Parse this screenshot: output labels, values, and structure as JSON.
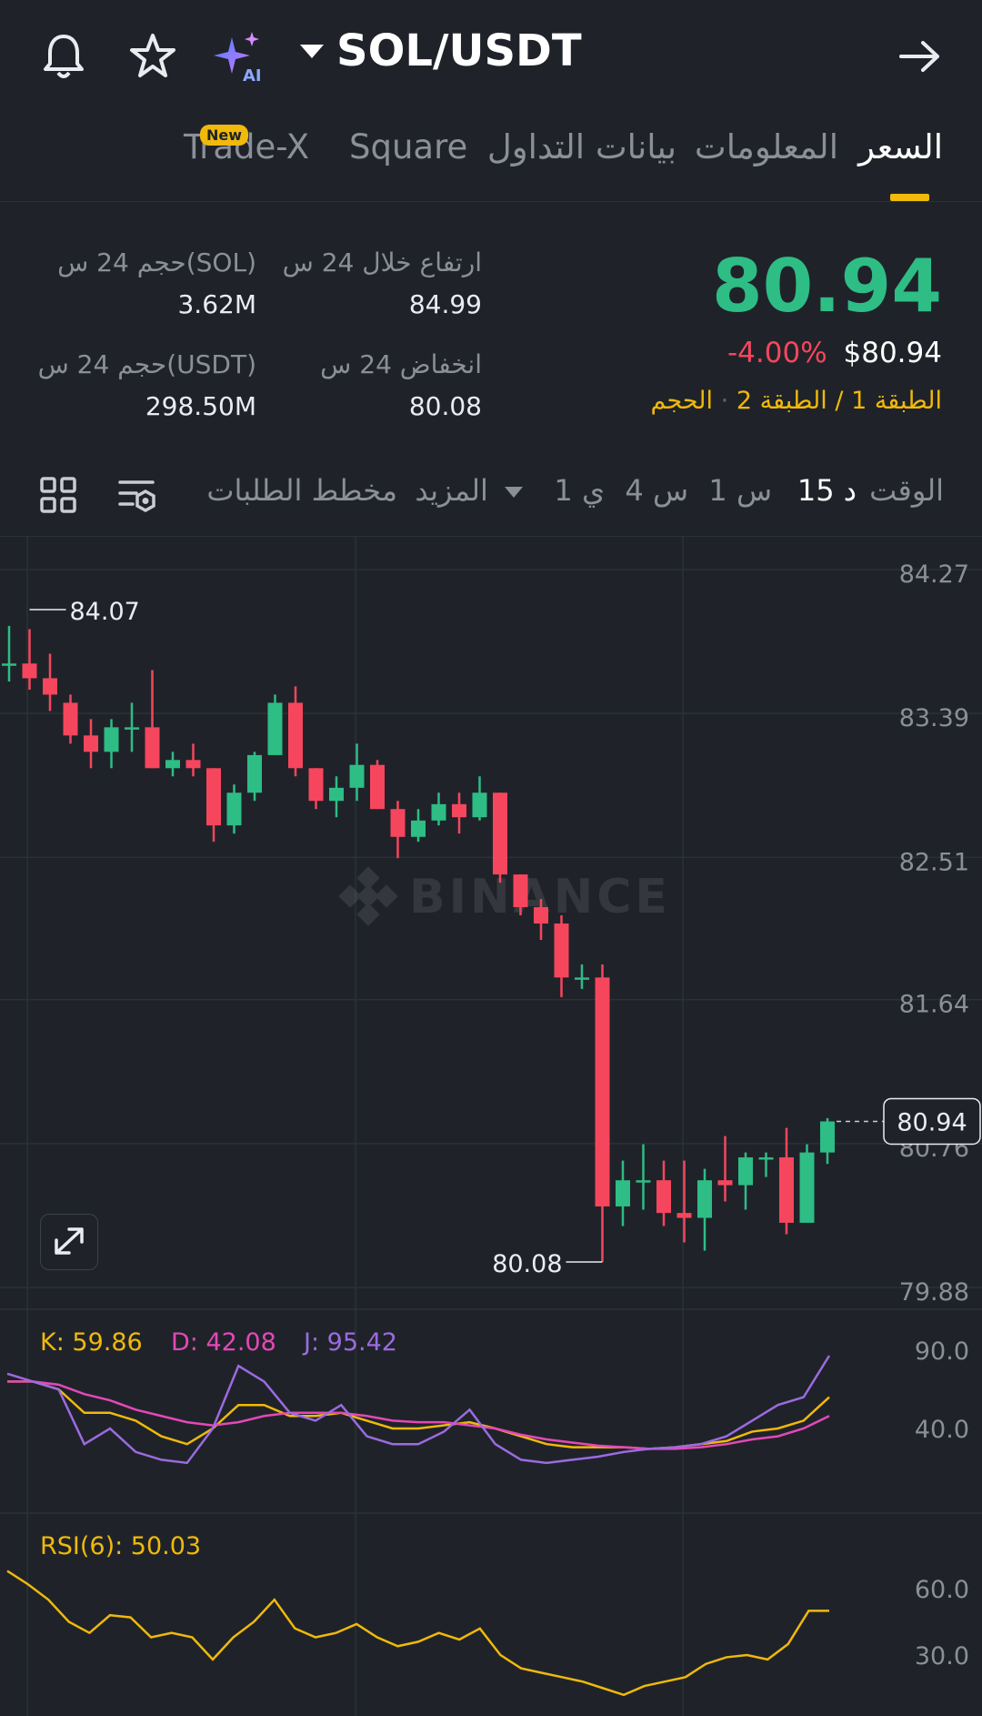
{
  "header": {
    "pair": "SOL/USDT",
    "icons": [
      "bell-icon",
      "star-icon",
      "ai-sparkle-icon",
      "dropdown-caret-icon",
      "arrow-right-icon"
    ],
    "ai_label": "AI"
  },
  "tabs": [
    {
      "label": "السعر",
      "active": true
    },
    {
      "label": "المعلومات",
      "active": false
    },
    {
      "label": "بيانات التداول",
      "active": false
    },
    {
      "label": "Square",
      "active": false
    },
    {
      "label": "Trade-X",
      "active": false,
      "badge": "New"
    }
  ],
  "ticker": {
    "last_price": "80.94",
    "change_pct": "-4.00%",
    "usd_price": "$80.94",
    "layers_text": {
      "layer1": "الطبقة 1",
      "sep1": "/",
      "layer2": "الطبقة 2",
      "dot": "·",
      "volume": "الحجم"
    },
    "stats": {
      "high_label": "ارتفاع خلال 24 س",
      "high_value": "84.99",
      "low_label": "انخفاض 24 س",
      "low_value": "80.08",
      "vol_sol_label": "حجم 24 س(SOL)",
      "vol_sol_value": "3.62M",
      "vol_usdt_label": "حجم 24 س(USDT)",
      "vol_usdt_value": "298.50M"
    },
    "colors": {
      "up": "#2ebd85",
      "down": "#f6465d",
      "accent": "#f0b90b"
    }
  },
  "toolbar": {
    "time_label": "الوقت",
    "intervals": [
      {
        "label": "15 د",
        "selected": true
      },
      {
        "label": "1 س",
        "selected": false
      },
      {
        "label": "4 س",
        "selected": false
      },
      {
        "label": "1 ي",
        "selected": false
      }
    ],
    "more_label": "المزيد",
    "orderbook_chart_label": "مخطط الطلبات",
    "icons": [
      "chart-settings-icon",
      "grid-layout-icon"
    ]
  },
  "chart_data": [
    {
      "type": "candlestick",
      "watermark": "BINANCE",
      "y_ticks": [
        "84.27",
        "83.39",
        "82.51",
        "81.64",
        "80.76",
        "79.88"
      ],
      "ylim": [
        79.88,
        84.27
      ],
      "current_price_tag": "80.94",
      "high_marker": "84.07",
      "low_marker": "80.08",
      "candles": [
        {
          "o": 83.74,
          "h": 83.97,
          "l": 83.63,
          "c": 83.74
        },
        {
          "o": 83.74,
          "h": 83.95,
          "l": 83.58,
          "c": 83.65
        },
        {
          "o": 83.65,
          "h": 83.8,
          "l": 83.45,
          "c": 83.55
        },
        {
          "o": 83.5,
          "h": 83.55,
          "l": 83.25,
          "c": 83.3
        },
        {
          "o": 83.3,
          "h": 83.4,
          "l": 83.1,
          "c": 83.2
        },
        {
          "o": 83.2,
          "h": 83.4,
          "l": 83.1,
          "c": 83.35
        },
        {
          "o": 83.35,
          "h": 83.5,
          "l": 83.2,
          "c": 83.35
        },
        {
          "o": 83.35,
          "h": 83.7,
          "l": 83.1,
          "c": 83.1
        },
        {
          "o": 83.1,
          "h": 83.2,
          "l": 83.05,
          "c": 83.15
        },
        {
          "o": 83.15,
          "h": 83.25,
          "l": 83.05,
          "c": 83.1
        },
        {
          "o": 83.1,
          "h": 83.1,
          "l": 82.65,
          "c": 82.75
        },
        {
          "o": 82.75,
          "h": 83.0,
          "l": 82.7,
          "c": 82.95
        },
        {
          "o": 82.95,
          "h": 83.2,
          "l": 82.9,
          "c": 83.18
        },
        {
          "o": 83.18,
          "h": 83.55,
          "l": 83.18,
          "c": 83.5
        },
        {
          "o": 83.5,
          "h": 83.6,
          "l": 83.05,
          "c": 83.1
        },
        {
          "o": 83.1,
          "h": 83.1,
          "l": 82.85,
          "c": 82.9
        },
        {
          "o": 82.9,
          "h": 83.05,
          "l": 82.8,
          "c": 82.98
        },
        {
          "o": 82.98,
          "h": 83.25,
          "l": 82.9,
          "c": 83.12
        },
        {
          "o": 83.12,
          "h": 83.15,
          "l": 82.85,
          "c": 82.85
        },
        {
          "o": 82.85,
          "h": 82.9,
          "l": 82.55,
          "c": 82.68
        },
        {
          "o": 82.68,
          "h": 82.85,
          "l": 82.65,
          "c": 82.78
        },
        {
          "o": 82.78,
          "h": 82.95,
          "l": 82.75,
          "c": 82.88
        },
        {
          "o": 82.88,
          "h": 82.95,
          "l": 82.7,
          "c": 82.8
        },
        {
          "o": 82.8,
          "h": 83.05,
          "l": 82.78,
          "c": 82.95
        },
        {
          "o": 82.95,
          "h": 82.95,
          "l": 82.4,
          "c": 82.45
        },
        {
          "o": 82.45,
          "h": 82.45,
          "l": 82.2,
          "c": 82.25
        },
        {
          "o": 82.25,
          "h": 82.3,
          "l": 82.05,
          "c": 82.15
        },
        {
          "o": 82.15,
          "h": 82.2,
          "l": 81.7,
          "c": 81.82
        },
        {
          "o": 81.82,
          "h": 81.9,
          "l": 81.75,
          "c": 81.82
        },
        {
          "o": 81.82,
          "h": 81.9,
          "l": 80.08,
          "c": 80.42
        },
        {
          "o": 80.42,
          "h": 80.7,
          "l": 80.3,
          "c": 80.58
        },
        {
          "o": 80.58,
          "h": 80.8,
          "l": 80.4,
          "c": 80.58
        },
        {
          "o": 80.58,
          "h": 80.7,
          "l": 80.3,
          "c": 80.38
        },
        {
          "o": 80.38,
          "h": 80.7,
          "l": 80.2,
          "c": 80.35
        },
        {
          "o": 80.35,
          "h": 80.65,
          "l": 80.15,
          "c": 80.58
        },
        {
          "o": 80.58,
          "h": 80.85,
          "l": 80.45,
          "c": 80.55
        },
        {
          "o": 80.55,
          "h": 80.75,
          "l": 80.4,
          "c": 80.72
        },
        {
          "o": 80.72,
          "h": 80.75,
          "l": 80.6,
          "c": 80.72
        },
        {
          "o": 80.72,
          "h": 80.9,
          "l": 80.25,
          "c": 80.32
        },
        {
          "o": 80.32,
          "h": 80.8,
          "l": 80.32,
          "c": 80.75
        },
        {
          "o": 80.75,
          "h": 80.96,
          "l": 80.68,
          "c": 80.94
        }
      ]
    },
    {
      "type": "line",
      "indicator": "KDJ",
      "legend": [
        {
          "label": "K: 59.86",
          "color": "#f0b90b"
        },
        {
          "label": "D: 42.08",
          "color": "#e448b8"
        },
        {
          "label": "J: 95.42",
          "color": "#9b6be0"
        }
      ],
      "y_ticks": [
        "90.0",
        "40.0"
      ],
      "series": [
        {
          "name": "K",
          "color": "#f0b90b",
          "values": [
            70,
            70,
            65,
            50,
            50,
            45,
            35,
            30,
            40,
            55,
            55,
            48,
            48,
            50,
            45,
            40,
            40,
            42,
            44,
            40,
            35,
            30,
            28,
            28,
            28,
            27,
            28,
            30,
            32,
            38,
            40,
            45,
            60
          ]
        },
        {
          "name": "D",
          "color": "#e448b8",
          "values": [
            70,
            70,
            68,
            62,
            58,
            52,
            48,
            44,
            42,
            44,
            48,
            50,
            50,
            50,
            48,
            45,
            44,
            44,
            42,
            40,
            36,
            33,
            31,
            29,
            28,
            27,
            27,
            28,
            30,
            33,
            35,
            40,
            48
          ]
        },
        {
          "name": "J",
          "color": "#9b6be0",
          "values": [
            75,
            70,
            65,
            30,
            40,
            25,
            20,
            18,
            40,
            80,
            70,
            50,
            45,
            55,
            35,
            30,
            30,
            38,
            52,
            30,
            20,
            18,
            20,
            22,
            25,
            27,
            28,
            30,
            35,
            45,
            55,
            60,
            95
          ]
        }
      ]
    },
    {
      "type": "line",
      "indicator": "RSI",
      "legend": [
        {
          "label": "RSI(6): 50.03",
          "color": "#f0b90b"
        }
      ],
      "y_ticks": [
        "60.0",
        "30.0"
      ],
      "series": [
        {
          "name": "RSI(6)",
          "color": "#f0b90b",
          "values": [
            68,
            62,
            55,
            45,
            40,
            48,
            47,
            38,
            40,
            38,
            28,
            38,
            45,
            55,
            42,
            38,
            40,
            44,
            38,
            34,
            36,
            40,
            37,
            42,
            30,
            24,
            22,
            20,
            18,
            15,
            12,
            16,
            18,
            20,
            26,
            29,
            30,
            28,
            35,
            50,
            50
          ]
        }
      ]
    }
  ]
}
